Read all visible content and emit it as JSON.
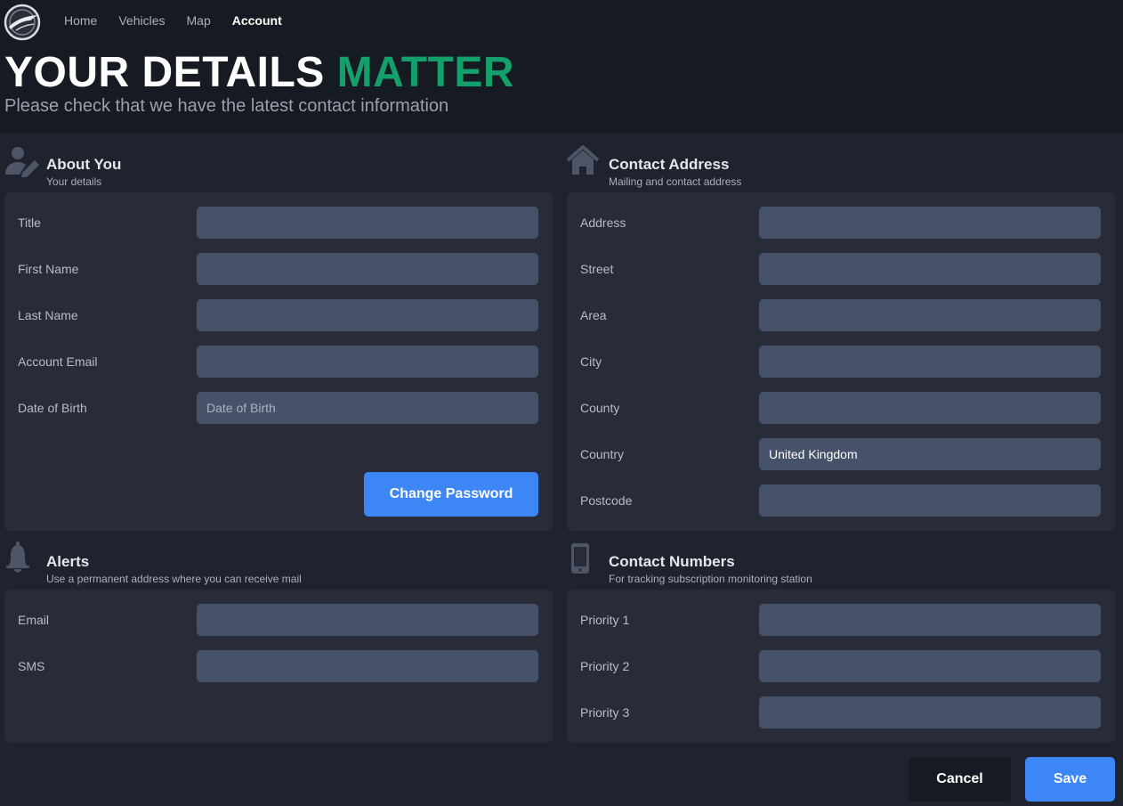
{
  "nav": {
    "items": [
      {
        "label": "Home",
        "active": false
      },
      {
        "label": "Vehicles",
        "active": false
      },
      {
        "label": "Map",
        "active": false
      },
      {
        "label": "Account",
        "active": true
      }
    ],
    "logo_icon": "globe-arrow-logo"
  },
  "hero": {
    "title_main": "YOUR DETAILS ",
    "title_accent": "MATTER",
    "subtitle": "Please check that we have the latest contact information",
    "accent_color": "#14a06b"
  },
  "about": {
    "icon": "user-edit-icon",
    "title": "About You",
    "subtitle": "Your details",
    "fields": [
      {
        "label": "Title",
        "value": "",
        "placeholder": ""
      },
      {
        "label": "First Name",
        "value": "",
        "placeholder": ""
      },
      {
        "label": "Last Name",
        "value": "",
        "placeholder": ""
      },
      {
        "label": "Account Email",
        "value": "",
        "placeholder": ""
      },
      {
        "label": "Date of Birth",
        "value": "",
        "placeholder": "Date of Birth"
      }
    ],
    "change_password_label": "Change Password"
  },
  "address": {
    "icon": "house-icon",
    "title": "Contact Address",
    "subtitle": "Mailing and contact address",
    "fields": [
      {
        "label": "Address",
        "value": "",
        "placeholder": ""
      },
      {
        "label": "Street",
        "value": "",
        "placeholder": ""
      },
      {
        "label": "Area",
        "value": "",
        "placeholder": ""
      },
      {
        "label": "City",
        "value": "",
        "placeholder": ""
      },
      {
        "label": "County",
        "value": "",
        "placeholder": ""
      },
      {
        "label": "Country",
        "value": "United Kingdom",
        "placeholder": ""
      },
      {
        "label": "Postcode",
        "value": "",
        "placeholder": ""
      }
    ]
  },
  "alerts": {
    "icon": "bell-icon",
    "title": "Alerts",
    "subtitle": "Use a permanent address where you can receive mail",
    "fields": [
      {
        "label": "Email",
        "value": "",
        "placeholder": ""
      },
      {
        "label": "SMS",
        "value": "",
        "placeholder": ""
      }
    ]
  },
  "numbers": {
    "icon": "mobile-phone-icon",
    "title": "Contact Numbers",
    "subtitle": "For tracking subscription monitoring station",
    "fields": [
      {
        "label": "Priority 1",
        "value": "",
        "placeholder": ""
      },
      {
        "label": "Priority 2",
        "value": "",
        "placeholder": ""
      },
      {
        "label": "Priority 3",
        "value": "",
        "placeholder": ""
      }
    ]
  },
  "footer": {
    "cancel_label": "Cancel",
    "save_label": "Save"
  },
  "colors": {
    "primary_button": "#3d86f6",
    "input_bg": "#465269",
    "card_bg": "#272c38",
    "page_bg": "#1f232d",
    "header_bg": "#161a22"
  }
}
